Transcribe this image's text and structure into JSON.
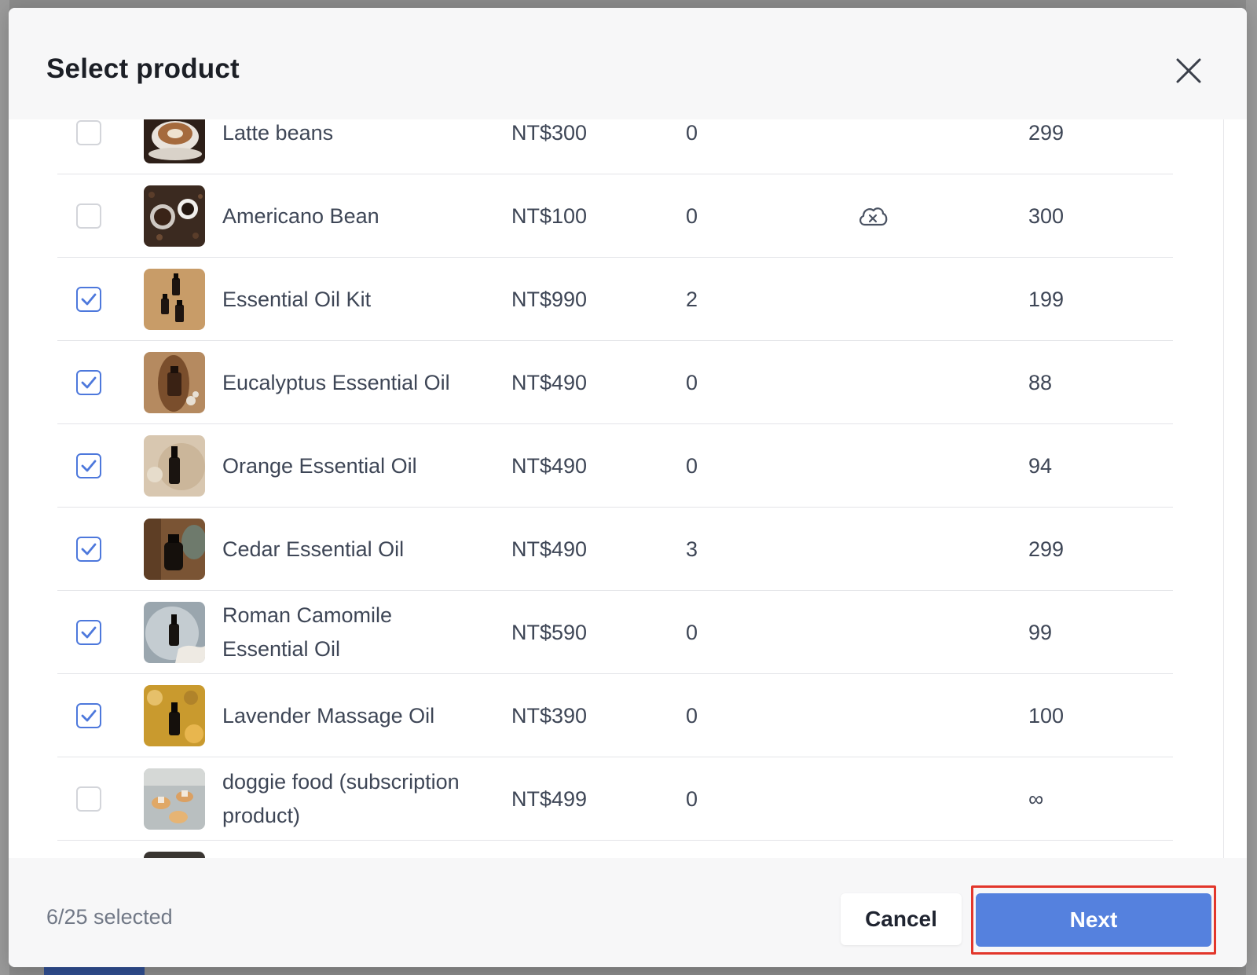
{
  "dialog": {
    "title": "Select product",
    "close_icon": "close-icon"
  },
  "products": [
    {
      "name": "Latte beans",
      "price": "NT$300",
      "qty": "0",
      "stock": "299",
      "checked": false,
      "status_icon": ""
    },
    {
      "name": "Americano Bean",
      "price": "NT$100",
      "qty": "0",
      "stock": "300",
      "checked": false,
      "status_icon": "cloud-x-icon"
    },
    {
      "name": "Essential Oil Kit",
      "price": "NT$990",
      "qty": "2",
      "stock": "199",
      "checked": true,
      "status_icon": ""
    },
    {
      "name": "Eucalyptus Essential Oil",
      "price": "NT$490",
      "qty": "0",
      "stock": "88",
      "checked": true,
      "status_icon": ""
    },
    {
      "name": "Orange Essential Oil",
      "price": "NT$490",
      "qty": "0",
      "stock": "94",
      "checked": true,
      "status_icon": ""
    },
    {
      "name": "Cedar Essential Oil",
      "price": "NT$490",
      "qty": "3",
      "stock": "299",
      "checked": true,
      "status_icon": ""
    },
    {
      "name": "Roman Camomile Essential Oil",
      "price": "NT$590",
      "qty": "0",
      "stock": "99",
      "checked": true,
      "status_icon": ""
    },
    {
      "name": "Lavender Massage Oil",
      "price": "NT$390",
      "qty": "0",
      "stock": "100",
      "checked": true,
      "status_icon": ""
    },
    {
      "name": "doggie food (subscription product)",
      "price": "NT$499",
      "qty": "0",
      "stock": "∞",
      "checked": false,
      "status_icon": ""
    }
  ],
  "footer": {
    "selected_count": "6/25 selected",
    "cancel_label": "Cancel",
    "next_label": "Next"
  },
  "colors": {
    "accent": "#5581de",
    "checkbox_checked": "#4d78dc",
    "highlight_outline": "#e2362b"
  }
}
